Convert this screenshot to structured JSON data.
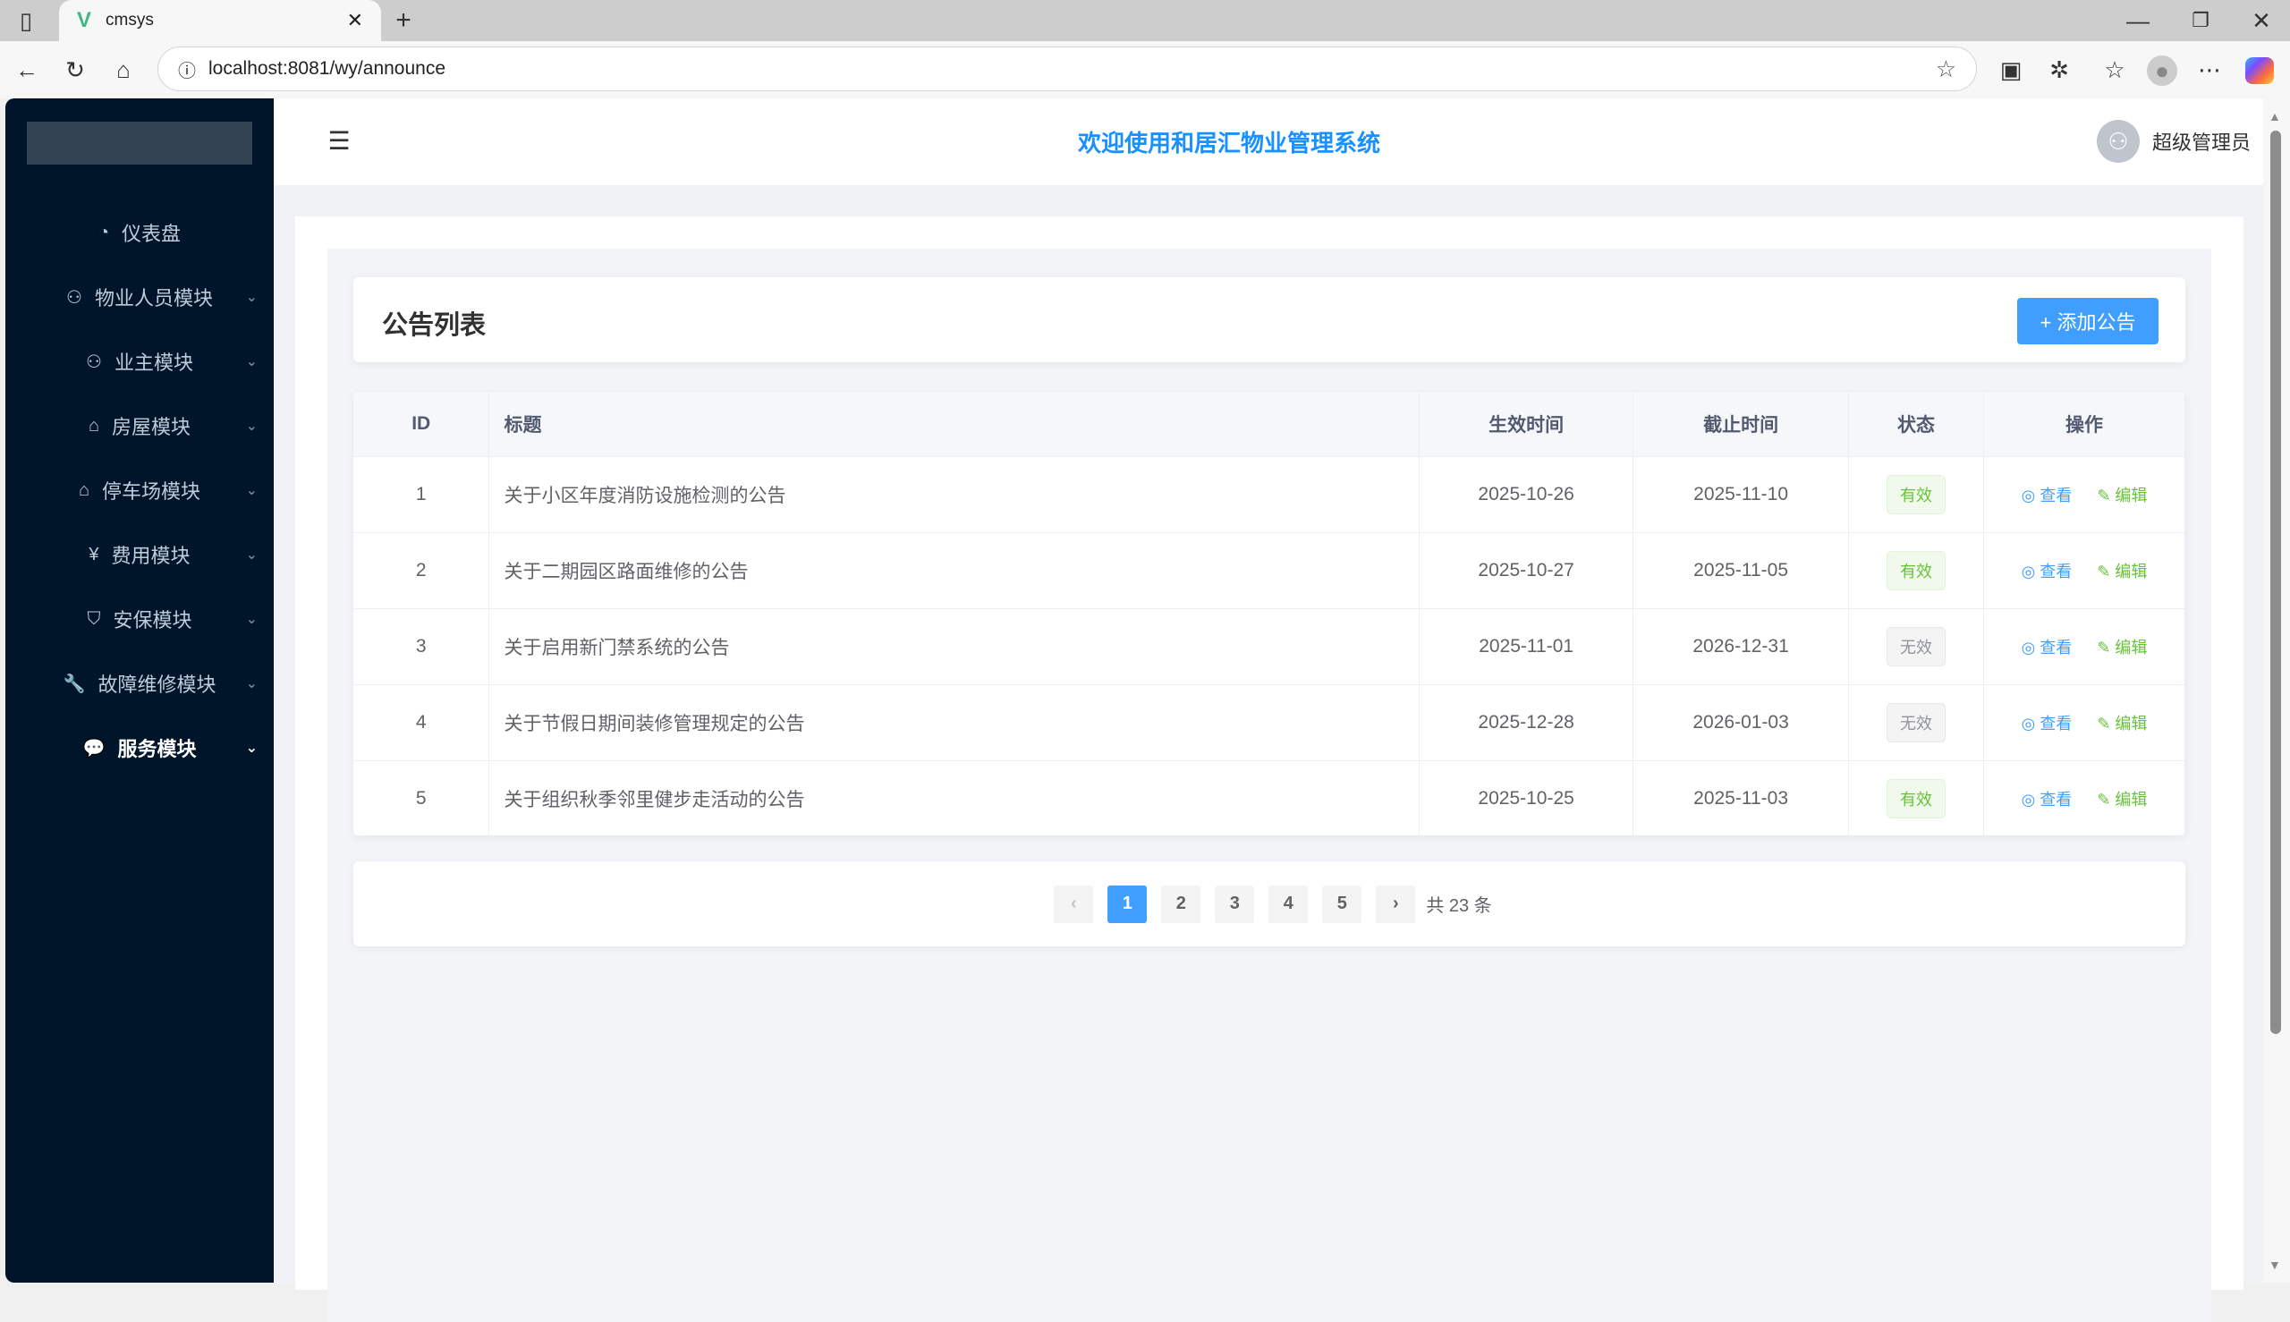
{
  "browser": {
    "tab_title": "cmsys",
    "url": "localhost:8081/wy/announce"
  },
  "header": {
    "title": "欢迎使用和居汇物业管理系统",
    "user": "超级管理员"
  },
  "sidebar": {
    "items": [
      {
        "label": "仪表盘",
        "icon": "pie-chart-icon",
        "glyph": "◔"
      },
      {
        "label": "物业人员模块",
        "icon": "user-icon",
        "glyph": "⚇"
      },
      {
        "label": "业主模块",
        "icon": "user-icon",
        "glyph": "⚇"
      },
      {
        "label": "房屋模块",
        "icon": "house-icon",
        "glyph": "⌂"
      },
      {
        "label": "停车场模块",
        "icon": "house-icon",
        "glyph": "⌂"
      },
      {
        "label": "费用模块",
        "icon": "money-icon",
        "glyph": "¥"
      },
      {
        "label": "安保模块",
        "icon": "shield-icon",
        "glyph": "⛉"
      },
      {
        "label": "故障维修模块",
        "icon": "wrench-icon",
        "glyph": "🔧"
      },
      {
        "label": "服务模块",
        "icon": "chat-icon",
        "glyph": "💬"
      }
    ]
  },
  "page": {
    "title": "公告列表",
    "add_label": "+ 添加公告"
  },
  "table": {
    "columns": [
      "ID",
      "标题",
      "生效时间",
      "截止时间",
      "状态",
      "操作"
    ],
    "view_label": "◎ 查看",
    "edit_label": "✎ 编辑",
    "rows": [
      {
        "id": "1",
        "title": "关于小区年度消防设施检测的公告",
        "start": "2025-10-26",
        "end": "2025-11-10",
        "status": "有效"
      },
      {
        "id": "2",
        "title": "关于二期园区路面维修的公告",
        "start": "2025-10-27",
        "end": "2025-11-05",
        "status": "有效"
      },
      {
        "id": "3",
        "title": "关于启用新门禁系统的公告",
        "start": "2025-11-01",
        "end": "2026-12-31",
        "status": "无效"
      },
      {
        "id": "4",
        "title": "关于节假日期间装修管理规定的公告",
        "start": "2025-12-28",
        "end": "2026-01-03",
        "status": "无效"
      },
      {
        "id": "5",
        "title": "关于组织秋季邻里健步走活动的公告",
        "start": "2025-10-25",
        "end": "2025-11-03",
        "status": "有效"
      }
    ]
  },
  "pagination": {
    "pages": [
      "1",
      "2",
      "3",
      "4",
      "5"
    ],
    "current": "1",
    "total": "共 23 条"
  }
}
